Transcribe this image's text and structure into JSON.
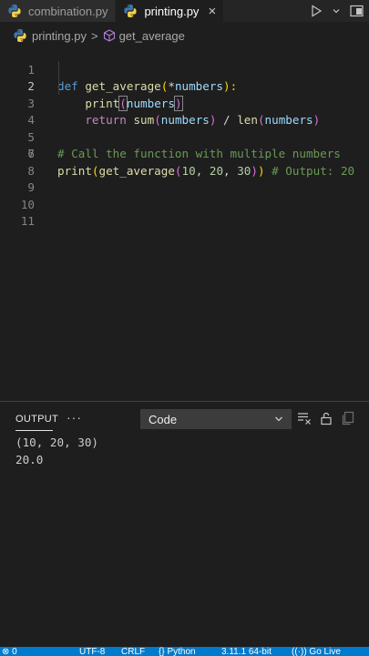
{
  "tabs": [
    {
      "label": "combination.py",
      "active": false
    },
    {
      "label": "printing.py",
      "active": true
    }
  ],
  "tab_close": "×",
  "breadcrumb": {
    "file": "printing.py",
    "separator": ">",
    "symbol": "get_average"
  },
  "editor": {
    "lines": [
      "1",
      "2",
      "3",
      "4",
      "5",
      "6",
      "7",
      "8",
      "9",
      "10",
      "11"
    ],
    "current_line": "2",
    "code": {
      "l1": {
        "kw": "def",
        "fn": "get_average",
        "open": "(",
        "star": "*",
        "param": "numbers",
        "close": "):"
      },
      "l2": {
        "fn": "print",
        "open": "(",
        "arg": "numbers",
        "close": ")"
      },
      "l3": {
        "kw": "return",
        "fn1": "sum",
        "open1": "(",
        "arg1": "numbers",
        "close1": ")",
        "op": " / ",
        "fn2": "len",
        "open2": "(",
        "arg2": "numbers",
        "close2": ")"
      },
      "l5": {
        "comment": "# Call the function with multiple numbers"
      },
      "l6": {
        "fn1": "print",
        "open1": "(",
        "fn2": "get_average",
        "open2": "(",
        "n1": "10",
        "sep1": ", ",
        "n2": "20",
        "sep2": ", ",
        "n3": "30",
        "close2": ")",
        "close1": ")",
        "comment": " # Output: 20"
      }
    }
  },
  "panel": {
    "title": "OUTPUT",
    "more": "···",
    "dropdown_value": "Code",
    "output_lines": [
      "(10, 20, 30)",
      "20.0"
    ]
  },
  "statusbar": {
    "left": "⊗ 0",
    "encoding": "UTF-8",
    "eol": "CRLF",
    "language": "{} Python",
    "interpreter": "3.11.1 64-bit",
    "live": "((·)) Go Live"
  },
  "colors": {
    "accent": "#007acc",
    "keyword": "#569cd6",
    "function": "#dcdcaa",
    "variable": "#9cdcfe",
    "number": "#b5cea8",
    "comment": "#6a9955"
  }
}
